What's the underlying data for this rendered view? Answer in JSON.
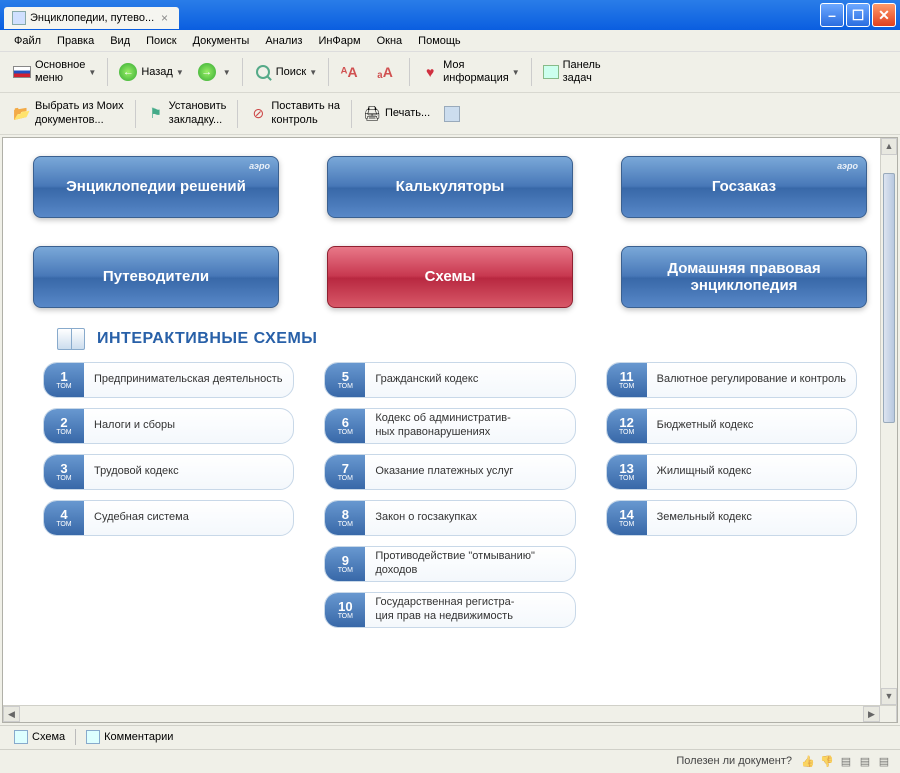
{
  "titlebar": {
    "tab_title": "Энциклопедии, путево..."
  },
  "menu": [
    "Файл",
    "Правка",
    "Вид",
    "Поиск",
    "Документы",
    "Анализ",
    "ИнФарм",
    "Окна",
    "Помощь"
  ],
  "toolbar1": {
    "main_menu": "Основное\nменю",
    "back": "Назад",
    "search": "Поиск",
    "my_info": "Моя\nинформация",
    "task_panel": "Панель\nзадач"
  },
  "toolbar2": {
    "select_docs": "Выбрать из Моих\nдокументов...",
    "bookmark": "Установить\nзакладку...",
    "control": "Поставить на\nконтроль",
    "print": "Печать..."
  },
  "tiles": [
    {
      "label": "Энциклопедии решений",
      "color": "blue",
      "badge": "аэро"
    },
    {
      "label": "Калькуляторы",
      "color": "blue",
      "badge": ""
    },
    {
      "label": "Госзаказ",
      "color": "blue",
      "badge": "аэро"
    },
    {
      "label": "Путеводители",
      "color": "blue",
      "badge": ""
    },
    {
      "label": "Схемы",
      "color": "red",
      "badge": ""
    },
    {
      "label": "Домашняя правовая энциклопедия",
      "color": "blue",
      "badge": ""
    }
  ],
  "section_title": "ИНТЕРАКТИВНЫЕ СХЕМЫ",
  "tom_label": "ТОМ",
  "items_col1": [
    {
      "n": "1",
      "t": "Предпринимательская деятельность"
    },
    {
      "n": "2",
      "t": "Налоги и сборы"
    },
    {
      "n": "3",
      "t": "Трудовой кодекс"
    },
    {
      "n": "4",
      "t": "Судебная система"
    }
  ],
  "items_col2": [
    {
      "n": "5",
      "t": "Гражданский кодекс"
    },
    {
      "n": "6",
      "t": "Кодекс об административ-\nных правонарушениях"
    },
    {
      "n": "7",
      "t": "Оказание платежных услуг"
    },
    {
      "n": "8",
      "t": "Закон о госзакупках"
    },
    {
      "n": "9",
      "t": "Противодействие \"отмыванию\" доходов"
    },
    {
      "n": "10",
      "t": "Государственная регистра-\nция прав на недвижимость"
    }
  ],
  "items_col3": [
    {
      "n": "11",
      "t": "Валютное регулирование и контроль"
    },
    {
      "n": "12",
      "t": "Бюджетный кодекс"
    },
    {
      "n": "13",
      "t": "Жилищный кодекс"
    },
    {
      "n": "14",
      "t": "Земельный кодекс"
    }
  ],
  "bottom_tabs": {
    "schema": "Схема",
    "comments": "Комментарии"
  },
  "status": {
    "question": "Полезен ли документ?"
  }
}
